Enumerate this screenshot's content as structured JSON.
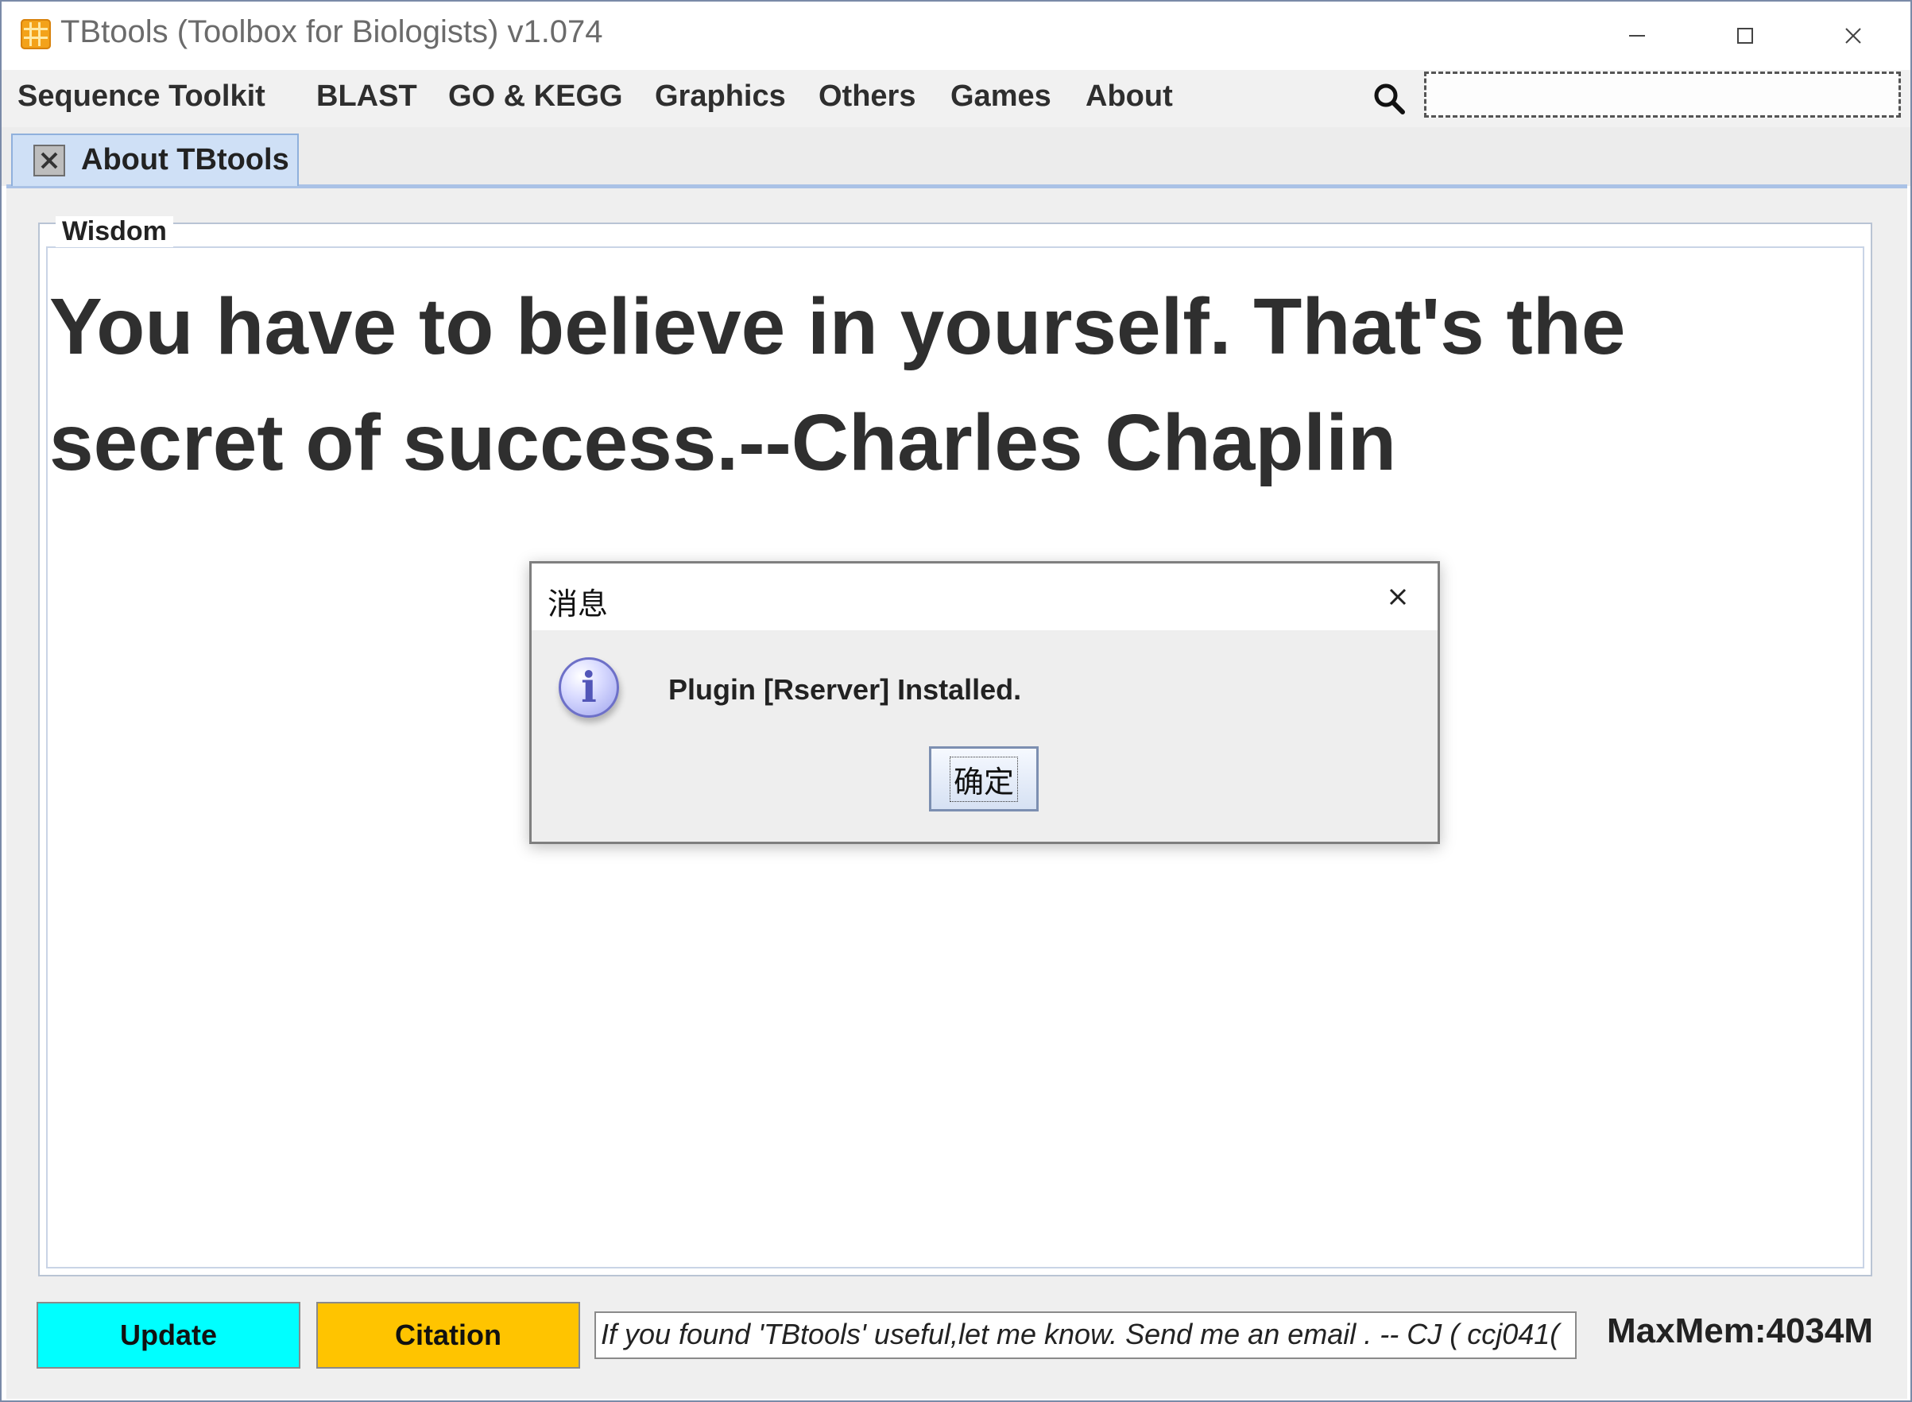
{
  "window": {
    "title": "TBtools (Toolbox for Biologists) v1.074"
  },
  "menu": {
    "items": [
      "Sequence Toolkit",
      "BLAST",
      "GO & KEGG",
      "Graphics",
      "Others",
      "Games",
      "About"
    ],
    "search_icon": "search-icon"
  },
  "tabs": {
    "active_label": "About TBtools"
  },
  "wisdom": {
    "legend": "Wisdom",
    "quote": "You have to believe in yourself. That's the secret of success.--Charles Chaplin"
  },
  "bottom": {
    "update_label": "Update",
    "citation_label": "Citation",
    "message": "If you found 'TBtools' useful,let me know. Send me an email . -- CJ   ( ccj041(",
    "maxmem": "MaxMem:4034M"
  },
  "dialog": {
    "title": "消息",
    "message": "Plugin [Rserver] Installed.",
    "ok_label": "确定",
    "icon": "info-icon"
  },
  "colors": {
    "update_button": "#00ffff",
    "citation_button": "#ffc400",
    "tab_active": "#cfe0f6",
    "app_icon": "#f3a21a"
  }
}
